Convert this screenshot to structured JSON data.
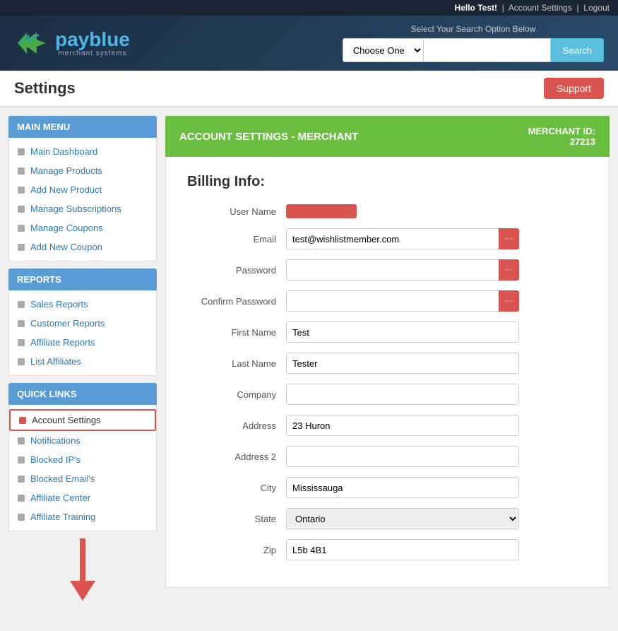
{
  "topbar": {
    "greeting": "Hello Test!",
    "account_settings_link": "Account Settings",
    "logout_link": "Logout"
  },
  "header": {
    "logo_text_pay": "pay",
    "logo_text_blue": "blue",
    "logo_subtitle": "merchant systems",
    "search_label": "Select Your Search Option Below",
    "search_placeholder": "",
    "search_select_default": "Choose One",
    "search_btn_label": "Search"
  },
  "page": {
    "title": "Settings",
    "support_btn": "Support"
  },
  "sidebar": {
    "main_menu_header": "MAIN MENU",
    "main_menu_items": [
      {
        "label": "Main Dashboard",
        "active": false
      },
      {
        "label": "Manage Products",
        "active": false
      },
      {
        "label": "Add New Product",
        "active": false
      },
      {
        "label": "Manage Subscriptions",
        "active": false
      },
      {
        "label": "Manage Coupons",
        "active": false
      },
      {
        "label": "Add New Coupon",
        "active": false
      }
    ],
    "reports_header": "REPORTS",
    "reports_items": [
      {
        "label": "Sales Reports",
        "active": false
      },
      {
        "label": "Customer Reports",
        "active": false
      },
      {
        "label": "Affiliate Reports",
        "active": false
      },
      {
        "label": "List Affiliates",
        "active": false
      }
    ],
    "quick_links_header": "QUICK LINKS",
    "quick_links_items": [
      {
        "label": "Account Settings",
        "active": true
      },
      {
        "label": "Notifications",
        "active": false
      },
      {
        "label": "Blocked IP's",
        "active": false
      },
      {
        "label": "Blocked Email's",
        "active": false
      },
      {
        "label": "Affiliate Center",
        "active": false
      },
      {
        "label": "Affiliate Training",
        "active": false
      }
    ]
  },
  "content": {
    "header_title": "ACCOUNT SETTINGS - MERCHANT",
    "merchant_id_label": "MERCHANT ID:",
    "merchant_id_value": "27213",
    "billing_title": "Billing Info:",
    "fields": {
      "username_label": "User Name",
      "email_label": "Email",
      "email_value": "test@wishlistmember.com",
      "password_label": "Password",
      "password_value": "",
      "confirm_password_label": "Confirm Password",
      "confirm_password_value": "",
      "first_name_label": "First Name",
      "first_name_value": "Test",
      "last_name_label": "Last Name",
      "last_name_value": "Tester",
      "company_label": "Company",
      "company_value": "",
      "address_label": "Address",
      "address_value": "23 Huron",
      "address2_label": "Address 2",
      "address2_value": "",
      "city_label": "City",
      "city_value": "Mississauga",
      "state_label": "State",
      "state_value": "Ontario",
      "zip_label": "Zip",
      "zip_value": "L5b 4B1"
    }
  }
}
